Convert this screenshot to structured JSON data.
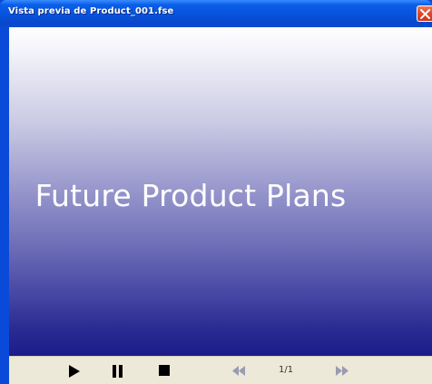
{
  "window": {
    "title": "Vista previa de Product_001.fse",
    "colors": {
      "titlebar": "#0a4ad8",
      "close": "#e0462a",
      "controls_bg": "#ece9d8"
    }
  },
  "slide": {
    "title": "Future Product Plans",
    "background": "vertical gradient white to navy (#1c1c8a)"
  },
  "controls": {
    "icons": [
      "play-icon",
      "pause-icon",
      "stop-icon",
      "rewind-icon",
      "fast-forward-icon"
    ],
    "page_indicator": "1/1"
  }
}
